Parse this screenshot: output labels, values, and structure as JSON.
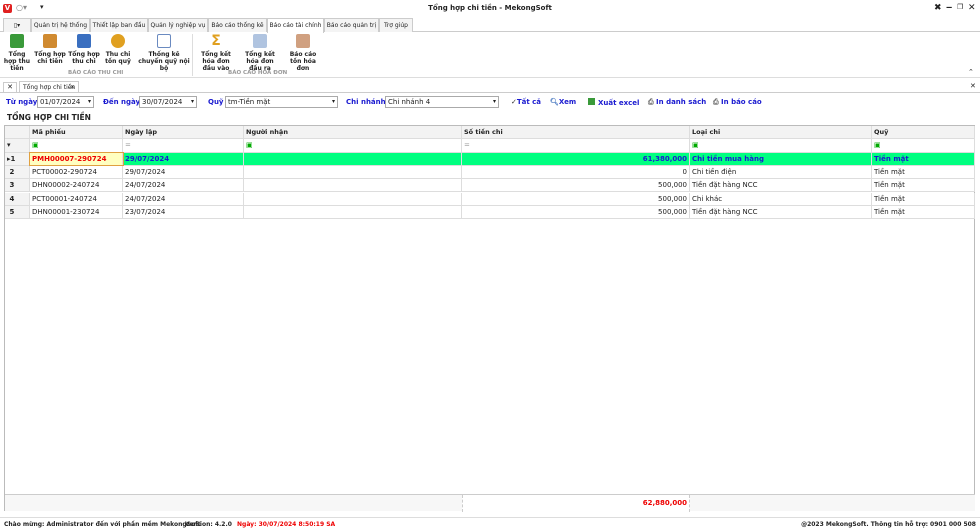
{
  "window": {
    "title": "Tổng hợp chi tiền - MekongSoft",
    "logo": "V"
  },
  "menu_tabs": [
    "Quản trị hệ thống",
    "Thiết lập ban đầu",
    "Quản lý nghiệp vụ",
    "Báo cáo thống kê",
    "Báo cáo tài chính",
    "Báo cáo quản trị",
    "Trợ giúp"
  ],
  "ribbon": {
    "buttons": [
      {
        "label": "Tổng hợp thu tiền",
        "color": "#3a9a3a"
      },
      {
        "label": "Tổng hợp chi tiền",
        "color": "#d08a30"
      },
      {
        "label": "Tổng hợp thu chi",
        "color": "#3a6fc0"
      },
      {
        "label": "Thu chi tồn quỹ",
        "color": "#e0a020"
      },
      {
        "label": "Thống kê chuyển quỹ nội bộ",
        "color": "#6a8ac0"
      },
      {
        "label": "Tổng kết hóa đơn đầu vào",
        "color": "#e0a020"
      },
      {
        "label": "Tổng kết hóa đơn đầu ra",
        "color": "#7090c0"
      },
      {
        "label": "Báo cáo tồn hóa đơn",
        "color": "#d08a50"
      }
    ],
    "groups": [
      "BÁO CÁO THU CHI",
      "BÁO CÁO HÓA ĐƠN"
    ]
  },
  "doc_tab": "Tổng hợp chi tiền",
  "filter": {
    "from_label": "Từ ngày",
    "from": "01/07/2024",
    "to_label": "Đến ngày",
    "to": "30/07/2024",
    "fund_label": "Quỹ",
    "fund": "tm-Tiền mặt",
    "branch_label": "Chi nhánh",
    "branch": "Chi nhánh 4",
    "all": "Tất cả",
    "view": "Xem",
    "export": "Xuất excel",
    "print_list": "In danh sách",
    "print_report": "In báo cáo"
  },
  "section_title": "TỔNG HỢP CHI TIỀN",
  "columns": [
    "Mã phiếu",
    "Ngày lập",
    "Người nhận",
    "Số tiền chi",
    "Loại chi",
    "Quỹ"
  ],
  "rows": [
    {
      "no": "1",
      "code": "PMH00007-290724",
      "date": "29/07/2024",
      "recipient": "",
      "amount": "61,380,000",
      "type": "Chi tiền mua hàng",
      "fund": "Tiền mặt"
    },
    {
      "no": "2",
      "code": "PCT00002-290724",
      "date": "29/07/2024",
      "recipient": "",
      "amount": "0",
      "type": "Chi tiền điện",
      "fund": "Tiền mặt"
    },
    {
      "no": "3",
      "code": "DHN00002-240724",
      "date": "24/07/2024",
      "recipient": "",
      "amount": "500,000",
      "type": "Tiền đặt hàng NCC",
      "fund": "Tiền mặt"
    },
    {
      "no": "4",
      "code": "PCT00001-240724",
      "date": "24/07/2024",
      "recipient": "",
      "amount": "500,000",
      "type": "Chi khác",
      "fund": "Tiền mặt"
    },
    {
      "no": "5",
      "code": "DHN00001-230724",
      "date": "23/07/2024",
      "recipient": "",
      "amount": "500,000",
      "type": "Tiền đặt hàng NCC",
      "fund": "Tiền mặt"
    }
  ],
  "total": "62,880,000",
  "status": {
    "welcome": "Chào mừng: Administrator đến với phần mềm MekongSoft",
    "version": "Version: 4.2.0",
    "date": "Ngày: 30/07/2024 8:50:19 SA",
    "copyright": "@2023 MekongSoft. Thông tin hỗ trợ: 0901 000 508"
  }
}
